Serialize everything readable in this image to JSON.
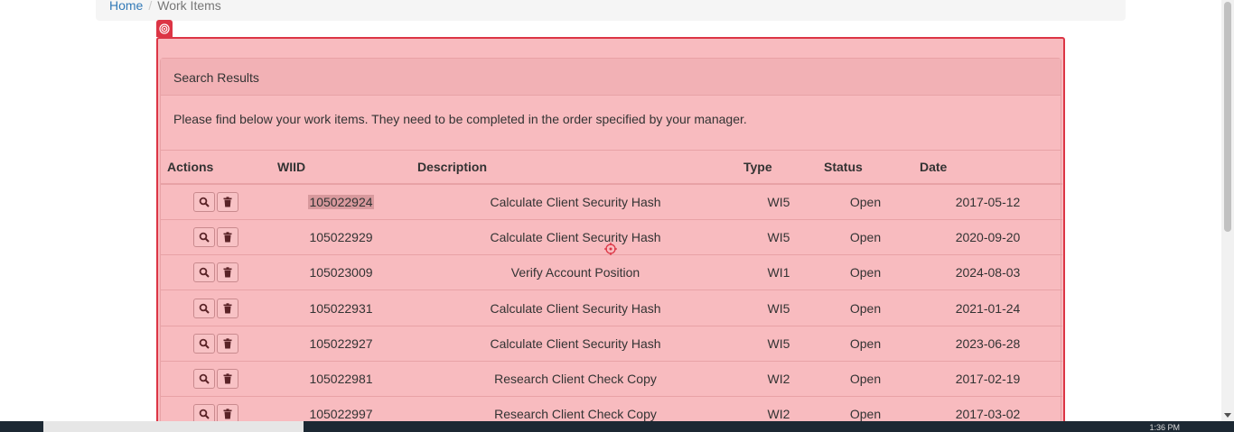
{
  "breadcrumb": {
    "home": "Home",
    "separator": "/",
    "current": "Work Items"
  },
  "panel": {
    "heading": "Search Results",
    "intro": "Please find below your work items. They need to be completed in the order specified by your manager."
  },
  "table": {
    "headers": {
      "actions": "Actions",
      "wiid": "WIID",
      "description": "Description",
      "type": "Type",
      "status": "Status",
      "date": "Date"
    },
    "rows": [
      {
        "wiid": "105022924",
        "description": "Calculate Client Security Hash",
        "type": "WI5",
        "status": "Open",
        "date": "2017-05-12"
      },
      {
        "wiid": "105022929",
        "description": "Calculate Client Security Hash",
        "type": "WI5",
        "status": "Open",
        "date": "2020-09-20"
      },
      {
        "wiid": "105023009",
        "description": "Verify Account Position",
        "type": "WI1",
        "status": "Open",
        "date": "2024-08-03"
      },
      {
        "wiid": "105022931",
        "description": "Calculate Client Security Hash",
        "type": "WI5",
        "status": "Open",
        "date": "2021-01-24"
      },
      {
        "wiid": "105022927",
        "description": "Calculate Client Security Hash",
        "type": "WI5",
        "status": "Open",
        "date": "2023-06-28"
      },
      {
        "wiid": "105022981",
        "description": "Research Client Check Copy",
        "type": "WI2",
        "status": "Open",
        "date": "2017-02-19"
      },
      {
        "wiid": "105022997",
        "description": "Research Client Check Copy",
        "type": "WI2",
        "status": "Open",
        "date": "2017-03-02"
      }
    ]
  },
  "icons": {
    "view": "search-icon",
    "delete": "trash-icon",
    "target": "target-icon"
  },
  "colors": {
    "highlight": "#f8bbbf",
    "highlight_border": "#dc3545",
    "link": "#337ab7"
  },
  "taskbar": {
    "clock": "1:36 PM"
  }
}
